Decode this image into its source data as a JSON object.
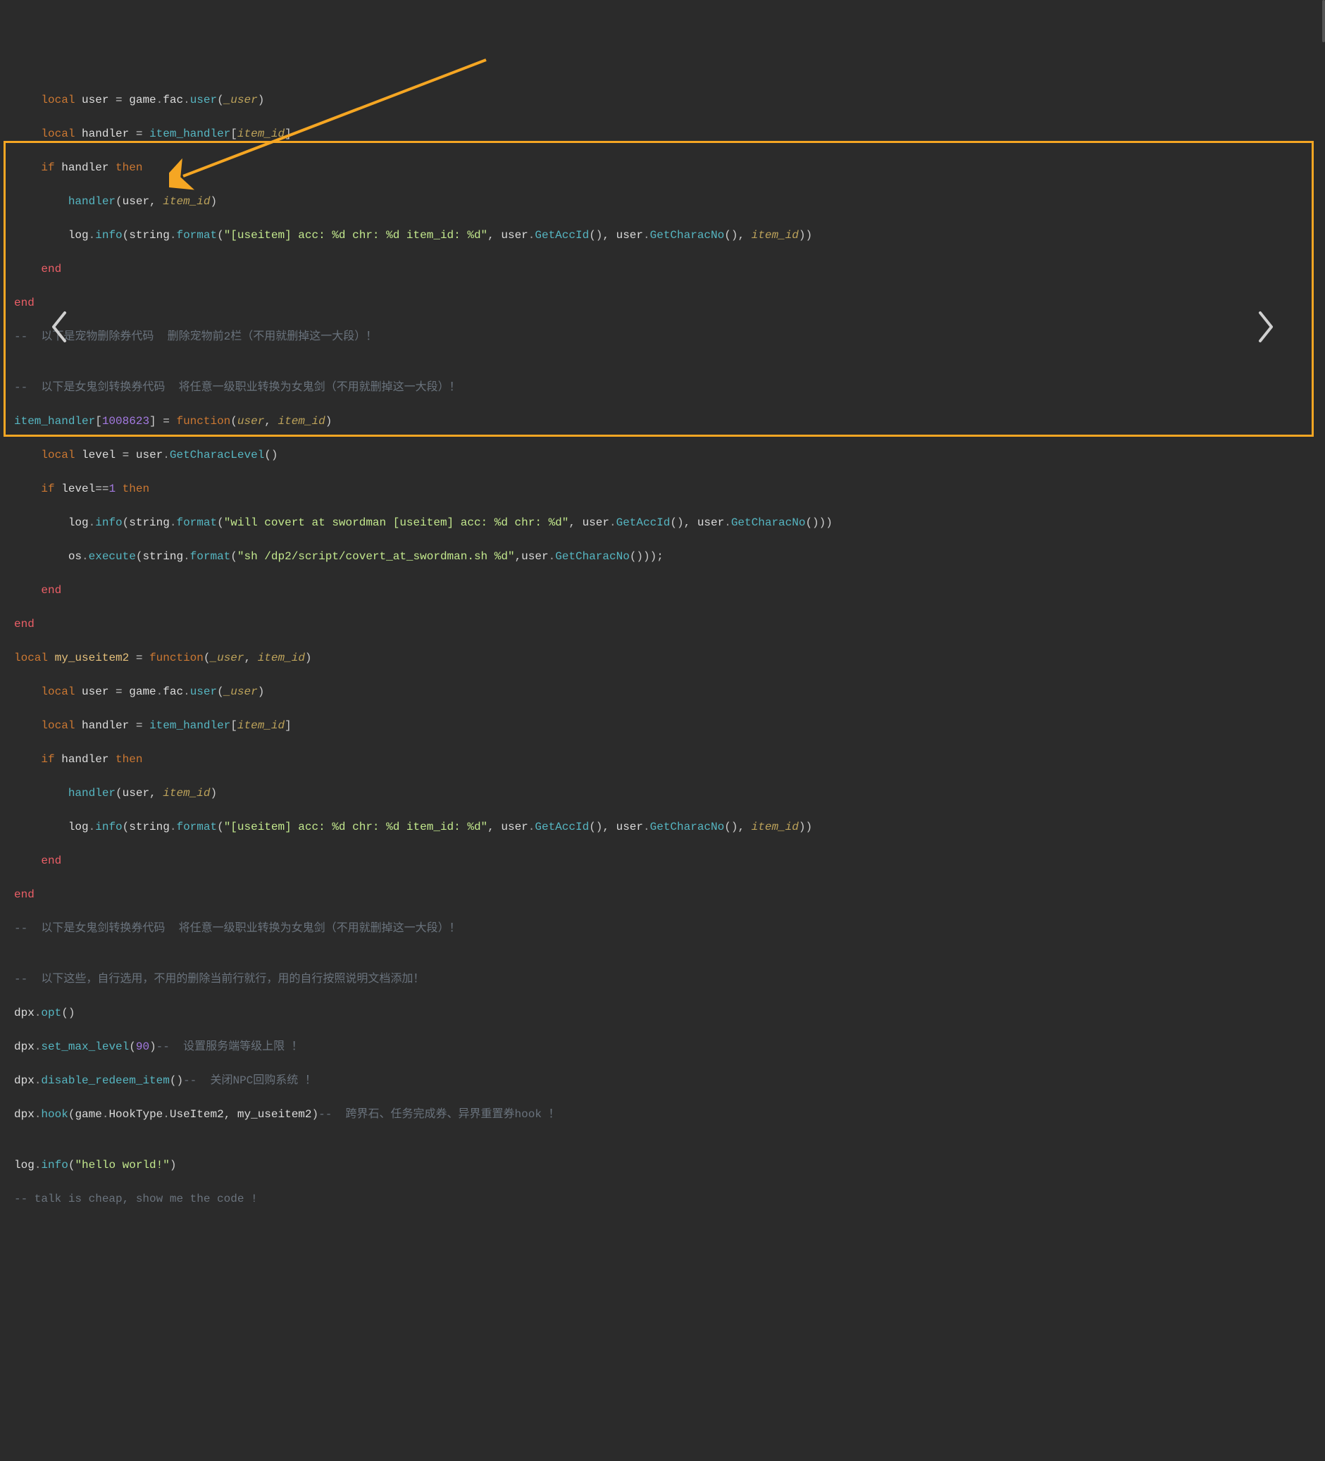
{
  "code": {
    "l1": [
      [
        "    ",
        "pad"
      ],
      [
        "local",
        "kw"
      ],
      [
        " ",
        "pad"
      ],
      [
        "user",
        "ident"
      ],
      [
        " = ",
        "op"
      ],
      [
        "game",
        "ident"
      ],
      [
        ".",
        "dot"
      ],
      [
        "fac",
        "ident"
      ],
      [
        ".",
        "dot"
      ],
      [
        "user",
        "fn"
      ],
      [
        "(",
        "op"
      ],
      [
        "_user",
        "param"
      ],
      [
        ")",
        "op"
      ]
    ],
    "l2": [
      [
        "    ",
        "pad"
      ],
      [
        "local",
        "kw"
      ],
      [
        " ",
        "pad"
      ],
      [
        "handler",
        "ident"
      ],
      [
        " = ",
        "op"
      ],
      [
        "item_handler",
        "fn"
      ],
      [
        "[",
        "op"
      ],
      [
        "item_id",
        "param"
      ],
      [
        "]",
        "op"
      ]
    ],
    "l3": [
      [
        "    ",
        "pad"
      ],
      [
        "if",
        "kw"
      ],
      [
        " ",
        "pad"
      ],
      [
        "handler",
        "ident"
      ],
      [
        " ",
        "pad"
      ],
      [
        "then",
        "kw"
      ]
    ],
    "l4": [
      [
        "        ",
        "pad"
      ],
      [
        "handler",
        "fn"
      ],
      [
        "(",
        "op"
      ],
      [
        "user",
        "ident"
      ],
      [
        ", ",
        "op"
      ],
      [
        "item_id",
        "param"
      ],
      [
        ")",
        "op"
      ]
    ],
    "l5": [
      [
        "        ",
        "pad"
      ],
      [
        "log",
        "ident"
      ],
      [
        ".",
        "dot"
      ],
      [
        "info",
        "fn"
      ],
      [
        "(",
        "op"
      ],
      [
        "string",
        "ident"
      ],
      [
        ".",
        "dot"
      ],
      [
        "format",
        "fn"
      ],
      [
        "(",
        "op"
      ],
      [
        "\"[useitem] acc: %d chr: %d item_id: %d\"",
        "str"
      ],
      [
        ", ",
        "op"
      ],
      [
        "user",
        "ident"
      ],
      [
        ".",
        "dot"
      ],
      [
        "GetAccId",
        "fn"
      ],
      [
        "()",
        "op"
      ],
      [
        ", ",
        "op"
      ],
      [
        "user",
        "ident"
      ],
      [
        ".",
        "dot"
      ],
      [
        "GetCharacNo",
        "fn"
      ],
      [
        "()",
        "op"
      ],
      [
        ", ",
        "op"
      ],
      [
        "item_id",
        "param"
      ],
      [
        "))",
        "op"
      ]
    ],
    "l6": [
      [
        "    ",
        "pad"
      ],
      [
        "end",
        "hotpink"
      ]
    ],
    "l7": [
      [
        "end",
        "hotpink"
      ]
    ],
    "l8": [
      [
        "--  以下是宠物删除券代码  删除宠物前2栏（不用就删掉这一大段）！",
        "cmt"
      ]
    ],
    "l9": [
      [
        "",
        "pad"
      ]
    ],
    "l10": [
      [
        "--  以下是女鬼剑转换券代码  将任意一级职业转换为女鬼剑（不用就删掉这一大段）！",
        "cmt"
      ]
    ],
    "l11": [
      [
        "item_handler",
        "fn"
      ],
      [
        "[",
        "op"
      ],
      [
        "1008623",
        "num"
      ],
      [
        "]",
        "op"
      ],
      [
        " = ",
        "op"
      ],
      [
        "function",
        "kw"
      ],
      [
        "(",
        "op"
      ],
      [
        "user",
        "param"
      ],
      [
        ", ",
        "op"
      ],
      [
        "item_id",
        "param"
      ],
      [
        ")",
        "op"
      ]
    ],
    "l12": [
      [
        "    ",
        "pad"
      ],
      [
        "local",
        "kw"
      ],
      [
        " ",
        "pad"
      ],
      [
        "level",
        "ident"
      ],
      [
        " = ",
        "op"
      ],
      [
        "user",
        "ident"
      ],
      [
        ".",
        "dot"
      ],
      [
        "GetCharacLevel",
        "fn"
      ],
      [
        "()",
        "op"
      ]
    ],
    "l13": [
      [
        "    ",
        "pad"
      ],
      [
        "if",
        "kw"
      ],
      [
        " ",
        "pad"
      ],
      [
        "level",
        "ident"
      ],
      [
        "==",
        "op"
      ],
      [
        "1",
        "num"
      ],
      [
        " ",
        "pad"
      ],
      [
        "then",
        "kw"
      ]
    ],
    "l14": [
      [
        "        ",
        "pad"
      ],
      [
        "log",
        "ident"
      ],
      [
        ".",
        "dot"
      ],
      [
        "info",
        "fn"
      ],
      [
        "(",
        "op"
      ],
      [
        "string",
        "ident"
      ],
      [
        ".",
        "dot"
      ],
      [
        "format",
        "fn"
      ],
      [
        "(",
        "op"
      ],
      [
        "\"will covert at swordman [useitem] acc: %d chr: %d\"",
        "str"
      ],
      [
        ", ",
        "op"
      ],
      [
        "user",
        "ident"
      ],
      [
        ".",
        "dot"
      ],
      [
        "GetAccId",
        "fn"
      ],
      [
        "()",
        "op"
      ],
      [
        ", ",
        "op"
      ],
      [
        "user",
        "ident"
      ],
      [
        ".",
        "dot"
      ],
      [
        "GetCharacNo",
        "fn"
      ],
      [
        "()))",
        "op"
      ]
    ],
    "l15": [
      [
        "        ",
        "pad"
      ],
      [
        "os",
        "ident"
      ],
      [
        ".",
        "dot"
      ],
      [
        "execute",
        "fn"
      ],
      [
        "(",
        "op"
      ],
      [
        "string",
        "ident"
      ],
      [
        ".",
        "dot"
      ],
      [
        "format",
        "fn"
      ],
      [
        "(",
        "op"
      ],
      [
        "\"sh /dp2/script/covert_at_swordman.sh %d\"",
        "str"
      ],
      [
        ",",
        "op"
      ],
      [
        "user",
        "ident"
      ],
      [
        ".",
        "dot"
      ],
      [
        "GetCharacNo",
        "fn"
      ],
      [
        "()));",
        "op"
      ]
    ],
    "l16": [
      [
        "    ",
        "pad"
      ],
      [
        "end",
        "hotpink"
      ]
    ],
    "l17": [
      [
        "end",
        "hotpink"
      ]
    ],
    "l18": [
      [
        "local",
        "kw"
      ],
      [
        " ",
        "pad"
      ],
      [
        "my_useitem2",
        "fname"
      ],
      [
        " = ",
        "op"
      ],
      [
        "function",
        "kw"
      ],
      [
        "(",
        "op"
      ],
      [
        "_user",
        "param"
      ],
      [
        ", ",
        "op"
      ],
      [
        "item_id",
        "param"
      ],
      [
        ")",
        "op"
      ]
    ],
    "l19": [
      [
        "    ",
        "pad"
      ],
      [
        "local",
        "kw"
      ],
      [
        " ",
        "pad"
      ],
      [
        "user",
        "ident"
      ],
      [
        " = ",
        "op"
      ],
      [
        "game",
        "ident"
      ],
      [
        ".",
        "dot"
      ],
      [
        "fac",
        "ident"
      ],
      [
        ".",
        "dot"
      ],
      [
        "user",
        "fn"
      ],
      [
        "(",
        "op"
      ],
      [
        "_user",
        "param"
      ],
      [
        ")",
        "op"
      ]
    ],
    "l20": [
      [
        "    ",
        "pad"
      ],
      [
        "local",
        "kw"
      ],
      [
        " ",
        "pad"
      ],
      [
        "handler",
        "ident"
      ],
      [
        " = ",
        "op"
      ],
      [
        "item_handler",
        "fn"
      ],
      [
        "[",
        "op"
      ],
      [
        "item_id",
        "param"
      ],
      [
        "]",
        "op"
      ]
    ],
    "l21": [
      [
        "    ",
        "pad"
      ],
      [
        "if",
        "kw"
      ],
      [
        " ",
        "pad"
      ],
      [
        "handler",
        "ident"
      ],
      [
        " ",
        "pad"
      ],
      [
        "then",
        "kw"
      ]
    ],
    "l22": [
      [
        "        ",
        "pad"
      ],
      [
        "handler",
        "fn"
      ],
      [
        "(",
        "op"
      ],
      [
        "user",
        "ident"
      ],
      [
        ", ",
        "op"
      ],
      [
        "item_id",
        "param"
      ],
      [
        ")",
        "op"
      ]
    ],
    "l23": [
      [
        "        ",
        "pad"
      ],
      [
        "log",
        "ident"
      ],
      [
        ".",
        "dot"
      ],
      [
        "info",
        "fn"
      ],
      [
        "(",
        "op"
      ],
      [
        "string",
        "ident"
      ],
      [
        ".",
        "dot"
      ],
      [
        "format",
        "fn"
      ],
      [
        "(",
        "op"
      ],
      [
        "\"[useitem] acc: %d chr: %d item_id: %d\"",
        "str"
      ],
      [
        ", ",
        "op"
      ],
      [
        "user",
        "ident"
      ],
      [
        ".",
        "dot"
      ],
      [
        "GetAccId",
        "fn"
      ],
      [
        "()",
        "op"
      ],
      [
        ", ",
        "op"
      ],
      [
        "user",
        "ident"
      ],
      [
        ".",
        "dot"
      ],
      [
        "GetCharacNo",
        "fn"
      ],
      [
        "()",
        "op"
      ],
      [
        ", ",
        "op"
      ],
      [
        "item_id",
        "param"
      ],
      [
        "))",
        "op"
      ]
    ],
    "l24": [
      [
        "    ",
        "pad"
      ],
      [
        "end",
        "hotpink"
      ]
    ],
    "l25": [
      [
        "end",
        "hotpink"
      ]
    ],
    "l26": [
      [
        "--  以下是女鬼剑转换券代码  将任意一级职业转换为女鬼剑（不用就删掉这一大段）！",
        "cmt"
      ]
    ],
    "l27": [
      [
        "",
        "pad"
      ]
    ],
    "l28": [
      [
        "--  以下这些，自行选用，不用的删除当前行就行，用的自行按照说明文档添加！",
        "cmt"
      ]
    ],
    "l29": [
      [
        "dpx",
        "ident"
      ],
      [
        ".",
        "dot"
      ],
      [
        "opt",
        "fn"
      ],
      [
        "()",
        "op"
      ]
    ],
    "l30": [
      [
        "dpx",
        "ident"
      ],
      [
        ".",
        "dot"
      ],
      [
        "set_max_level",
        "fn"
      ],
      [
        "(",
        "op"
      ],
      [
        "90",
        "num"
      ],
      [
        ")",
        "op"
      ],
      [
        "--  设置服务端等级上限 ！",
        "cmt"
      ]
    ],
    "l31": [
      [
        "dpx",
        "ident"
      ],
      [
        ".",
        "dot"
      ],
      [
        "disable_redeem_item",
        "fn"
      ],
      [
        "()",
        "op"
      ],
      [
        "--  关闭NPC回购系统 ！",
        "cmt"
      ]
    ],
    "l32": [
      [
        "dpx",
        "ident"
      ],
      [
        ".",
        "dot"
      ],
      [
        "hook",
        "fn"
      ],
      [
        "(",
        "op"
      ],
      [
        "game",
        "ident"
      ],
      [
        ".",
        "dot"
      ],
      [
        "HookType",
        "ident"
      ],
      [
        ".",
        "dot"
      ],
      [
        "UseItem2",
        "ident"
      ],
      [
        ", ",
        "op"
      ],
      [
        "my_useitem2",
        "ident"
      ],
      [
        ")",
        "op"
      ],
      [
        "--  跨界石、任务完成券、异界重置券hook ！",
        "cmt"
      ]
    ],
    "l33": [
      [
        "",
        "pad"
      ]
    ],
    "l34": [
      [
        "log",
        "ident"
      ],
      [
        ".",
        "dot"
      ],
      [
        "info",
        "fn"
      ],
      [
        "(",
        "op"
      ],
      [
        "\"hello world!\"",
        "str"
      ],
      [
        ")",
        "op"
      ]
    ],
    "l35": [
      [
        "-- talk is cheap, show me the code !",
        "cmt"
      ]
    ]
  },
  "annotation": {
    "arrow_color": "#f5a623",
    "box_color": "#f5a623"
  }
}
